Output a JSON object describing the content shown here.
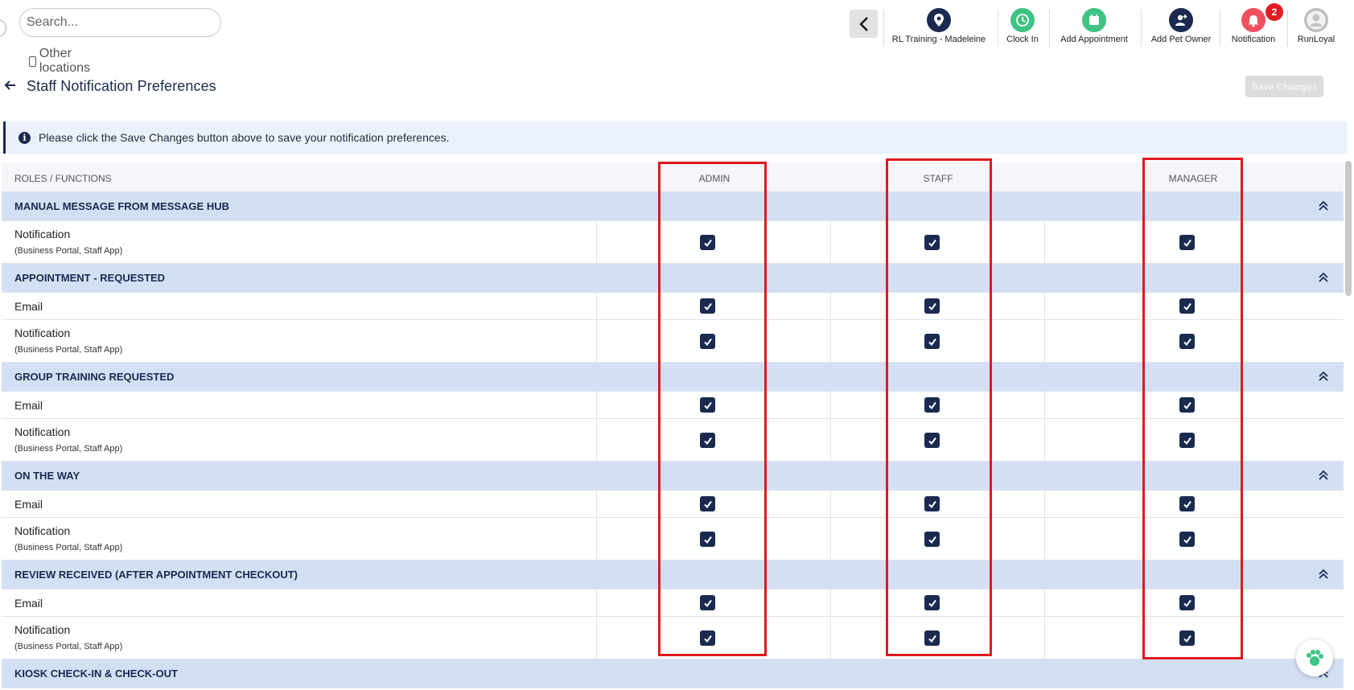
{
  "search": {
    "placeholder": "Search...",
    "other_locations_label": "Other locations"
  },
  "nav": {
    "items": [
      {
        "label": "RL Training - Madeleine",
        "icon": "location-pin-icon",
        "color": "#1a2a4f"
      },
      {
        "label": "Clock In",
        "icon": "clock-icon",
        "color": "#3ec383"
      },
      {
        "label": "Add Appointment",
        "icon": "add-appointment-icon",
        "color": "#3ec383"
      },
      {
        "label": "Add Pet Owner",
        "icon": "add-user-icon",
        "color": "#1a2a4f"
      },
      {
        "label": "Notification",
        "icon": "bell-icon",
        "color": "#f0505f",
        "badge": "2"
      },
      {
        "label": "RunLoyal",
        "icon": "user-avatar-icon",
        "color": "#bdbdbd"
      }
    ]
  },
  "page": {
    "title": "Staff Notification Preferences",
    "save_label": "Save Changes",
    "info_message": "Please click the Save Changes button above to save your notification preferences."
  },
  "table": {
    "headers": {
      "label": "ROLES / FUNCTIONS",
      "admin": "ADMIN",
      "staff": "STAFF",
      "manager": "MANAGER"
    },
    "sections": [
      {
        "title": "MANUAL MESSAGE FROM MESSAGE HUB",
        "rows": [
          {
            "label": "Notification",
            "sub": "(Business Portal, Staff App)",
            "admin": true,
            "staff": true,
            "manager": true
          }
        ]
      },
      {
        "title": "APPOINTMENT - REQUESTED",
        "rows": [
          {
            "label": "Email",
            "sub": "",
            "admin": true,
            "staff": true,
            "manager": true
          },
          {
            "label": "Notification",
            "sub": "(Business Portal, Staff App)",
            "admin": true,
            "staff": true,
            "manager": true
          }
        ]
      },
      {
        "title": "GROUP TRAINING REQUESTED",
        "rows": [
          {
            "label": "Email",
            "sub": "",
            "admin": true,
            "staff": true,
            "manager": true
          },
          {
            "label": "Notification",
            "sub": "(Business Portal, Staff App)",
            "admin": true,
            "staff": true,
            "manager": true
          }
        ]
      },
      {
        "title": "ON THE WAY",
        "rows": [
          {
            "label": "Email",
            "sub": "",
            "admin": true,
            "staff": true,
            "manager": true
          },
          {
            "label": "Notification",
            "sub": "(Business Portal, Staff App)",
            "admin": true,
            "staff": true,
            "manager": true
          }
        ]
      },
      {
        "title": "REVIEW RECEIVED (AFTER APPOINTMENT CHECKOUT)",
        "rows": [
          {
            "label": "Email",
            "sub": "",
            "admin": true,
            "staff": true,
            "manager": true
          },
          {
            "label": "Notification",
            "sub": "(Business Portal, Staff App)",
            "admin": true,
            "staff": true,
            "manager": true
          }
        ]
      },
      {
        "title": "KIOSK CHECK-IN & CHECK-OUT",
        "rows": []
      }
    ]
  },
  "colors": {
    "navy": "#1a2a4f",
    "highlight": "#e0191e",
    "section_bg": "#d3e0f4",
    "info_bg": "#eaf1fd"
  }
}
